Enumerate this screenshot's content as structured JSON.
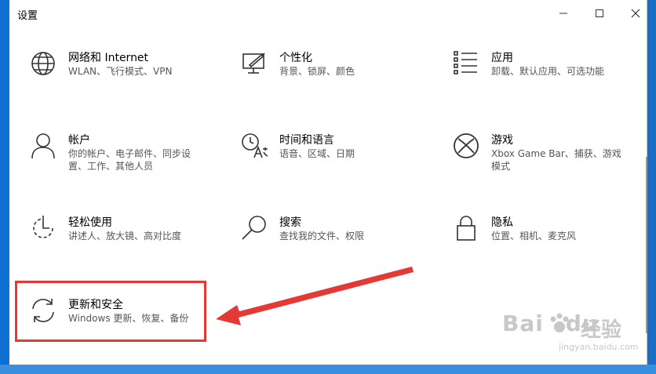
{
  "window": {
    "title": "设置"
  },
  "settings": [
    {
      "label": "网络和 Internet",
      "desc": "WLAN、飞行模式、VPN",
      "icon": "globe-icon"
    },
    {
      "label": "个性化",
      "desc": "背景、锁屏、颜色",
      "icon": "personalization-icon"
    },
    {
      "label": "应用",
      "desc": "卸载、默认应用、可选功能",
      "icon": "apps-list-icon"
    },
    {
      "label": "帐户",
      "desc": "你的帐户、电子邮件、同步设置、工作、其他人员",
      "icon": "person-icon"
    },
    {
      "label": "时间和语言",
      "desc": "语音、区域、日期",
      "icon": "time-language-icon"
    },
    {
      "label": "游戏",
      "desc": "Xbox Game Bar、捕获、游戏模式",
      "icon": "xbox-icon"
    },
    {
      "label": "轻松使用",
      "desc": "讲述人、放大镜、高对比度",
      "icon": "ease-of-access-icon"
    },
    {
      "label": "搜索",
      "desc": "查找我的文件、权限",
      "icon": "search-icon"
    },
    {
      "label": "隐私",
      "desc": "位置、相机、麦克风",
      "icon": "lock-icon"
    },
    {
      "label": "更新和安全",
      "desc": "Windows 更新、恢复、备份",
      "icon": "update-sync-icon"
    }
  ],
  "watermark": {
    "logo": "Bai",
    "logo_du": "du",
    "cn": "经验",
    "sub": "jingyan.baidu.com"
  },
  "colors": {
    "highlight": "#e53935",
    "accent": "#1a6fc4"
  }
}
